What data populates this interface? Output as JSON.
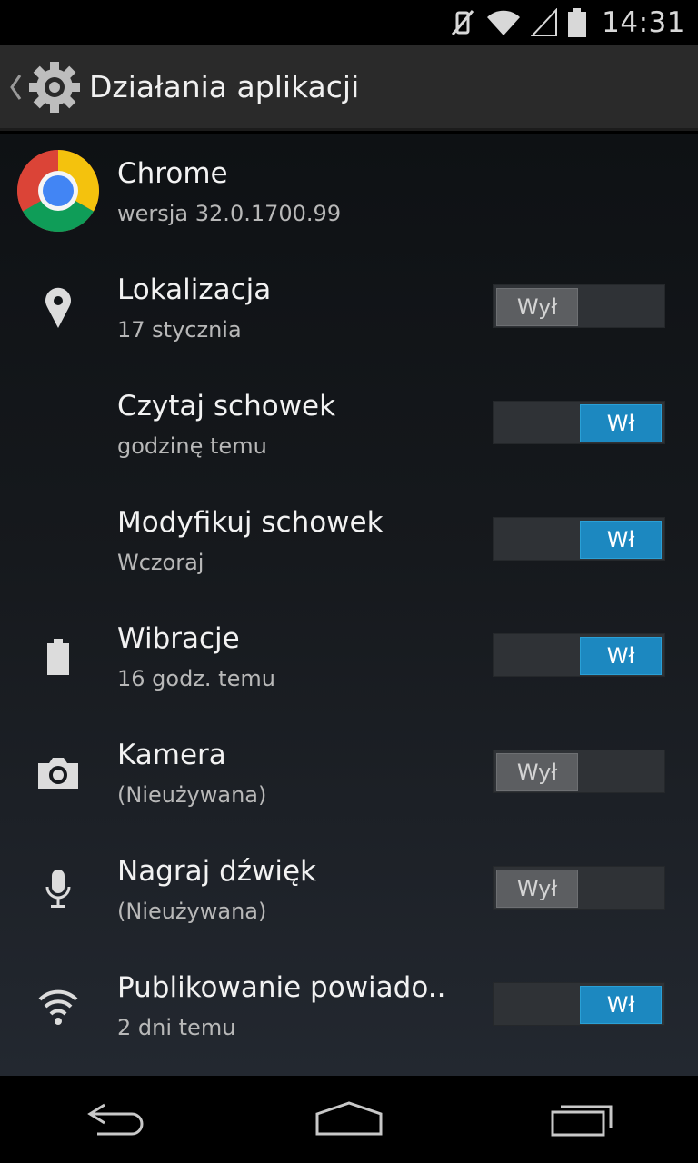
{
  "status_bar": {
    "time": "14:31",
    "icons": [
      "vibrate-muted-icon",
      "wifi-icon",
      "signal-icon",
      "battery-icon"
    ]
  },
  "action_bar": {
    "title": "Działania aplikacji",
    "back_icon": "chevron-left-icon",
    "settings_icon": "gear-icon"
  },
  "app": {
    "name": "Chrome",
    "version": "wersja 32.0.1700.99",
    "icon": "chrome-logo"
  },
  "permissions": [
    {
      "title": "Lokalizacja",
      "subtitle": "17 stycznia",
      "icon": "location-pin-icon",
      "state": "off",
      "toggle_label": "Wył"
    },
    {
      "title": "Czytaj schowek",
      "subtitle": "godzinę temu",
      "icon": "",
      "state": "on",
      "toggle_label": "Wł"
    },
    {
      "title": "Modyfikuj schowek",
      "subtitle": "Wczoraj",
      "icon": "",
      "state": "on",
      "toggle_label": "Wł"
    },
    {
      "title": "Wibracje",
      "subtitle": "16 godz. temu",
      "icon": "battery-vibrate-icon",
      "state": "on",
      "toggle_label": "Wł"
    },
    {
      "title": "Kamera",
      "subtitle": "(Nieużywana)",
      "icon": "camera-icon",
      "state": "off",
      "toggle_label": "Wył"
    },
    {
      "title": "Nagraj dźwięk",
      "subtitle": "(Nieużywana)",
      "icon": "microphone-icon",
      "state": "off",
      "toggle_label": "Wył"
    },
    {
      "title": "Publikowanie powiado..",
      "subtitle": "2 dni temu",
      "icon": "notification-wifi-icon",
      "state": "on",
      "toggle_label": "Wł"
    }
  ],
  "nav_bar": {
    "buttons": [
      "back-nav-icon",
      "home-nav-icon",
      "recents-nav-icon"
    ]
  },
  "colors": {
    "toggle_on": "#1c88c0",
    "toggle_off": "#5c5e61",
    "action_bar": "#2a2a2a"
  }
}
